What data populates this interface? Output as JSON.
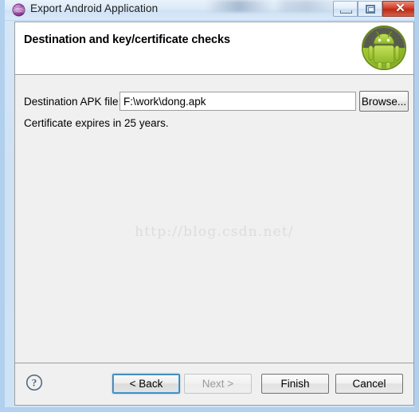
{
  "window": {
    "title": "Export Android Application",
    "title_icon": "eclipse-sphere-icon",
    "controls": {
      "minimize_label": "–",
      "maximize_label": "□",
      "close_label": "✕"
    }
  },
  "header": {
    "title": "Destination and key/certificate checks",
    "badge_icon": "android-robot-icon"
  },
  "form": {
    "destination_label": "Destination APK file:",
    "destination_value": "F:\\work\\dong.apk",
    "destination_placeholder": "",
    "browse_label": "Browse..."
  },
  "status": {
    "certificate_text": "Certificate expires in 25 years."
  },
  "watermark": {
    "text": "http://blog.csdn.net/"
  },
  "buttons": {
    "help_label": "?",
    "back_label": "< Back",
    "next_label": "Next >",
    "finish_label": "Finish",
    "cancel_label": "Cancel"
  },
  "colors": {
    "titlebar_start": "#e9f2fb",
    "titlebar_end": "#d9e9f8",
    "window_border": "#abcdec",
    "dialog_bg": "#f0f0f0",
    "header_bg": "#ffffff",
    "close_red": "#c8341d",
    "focus_blue": "#3c7fb1",
    "android_green": "#a4c639",
    "watermark_gray": "#dcdcdc",
    "disabled_text": "#9a9a9a"
  }
}
